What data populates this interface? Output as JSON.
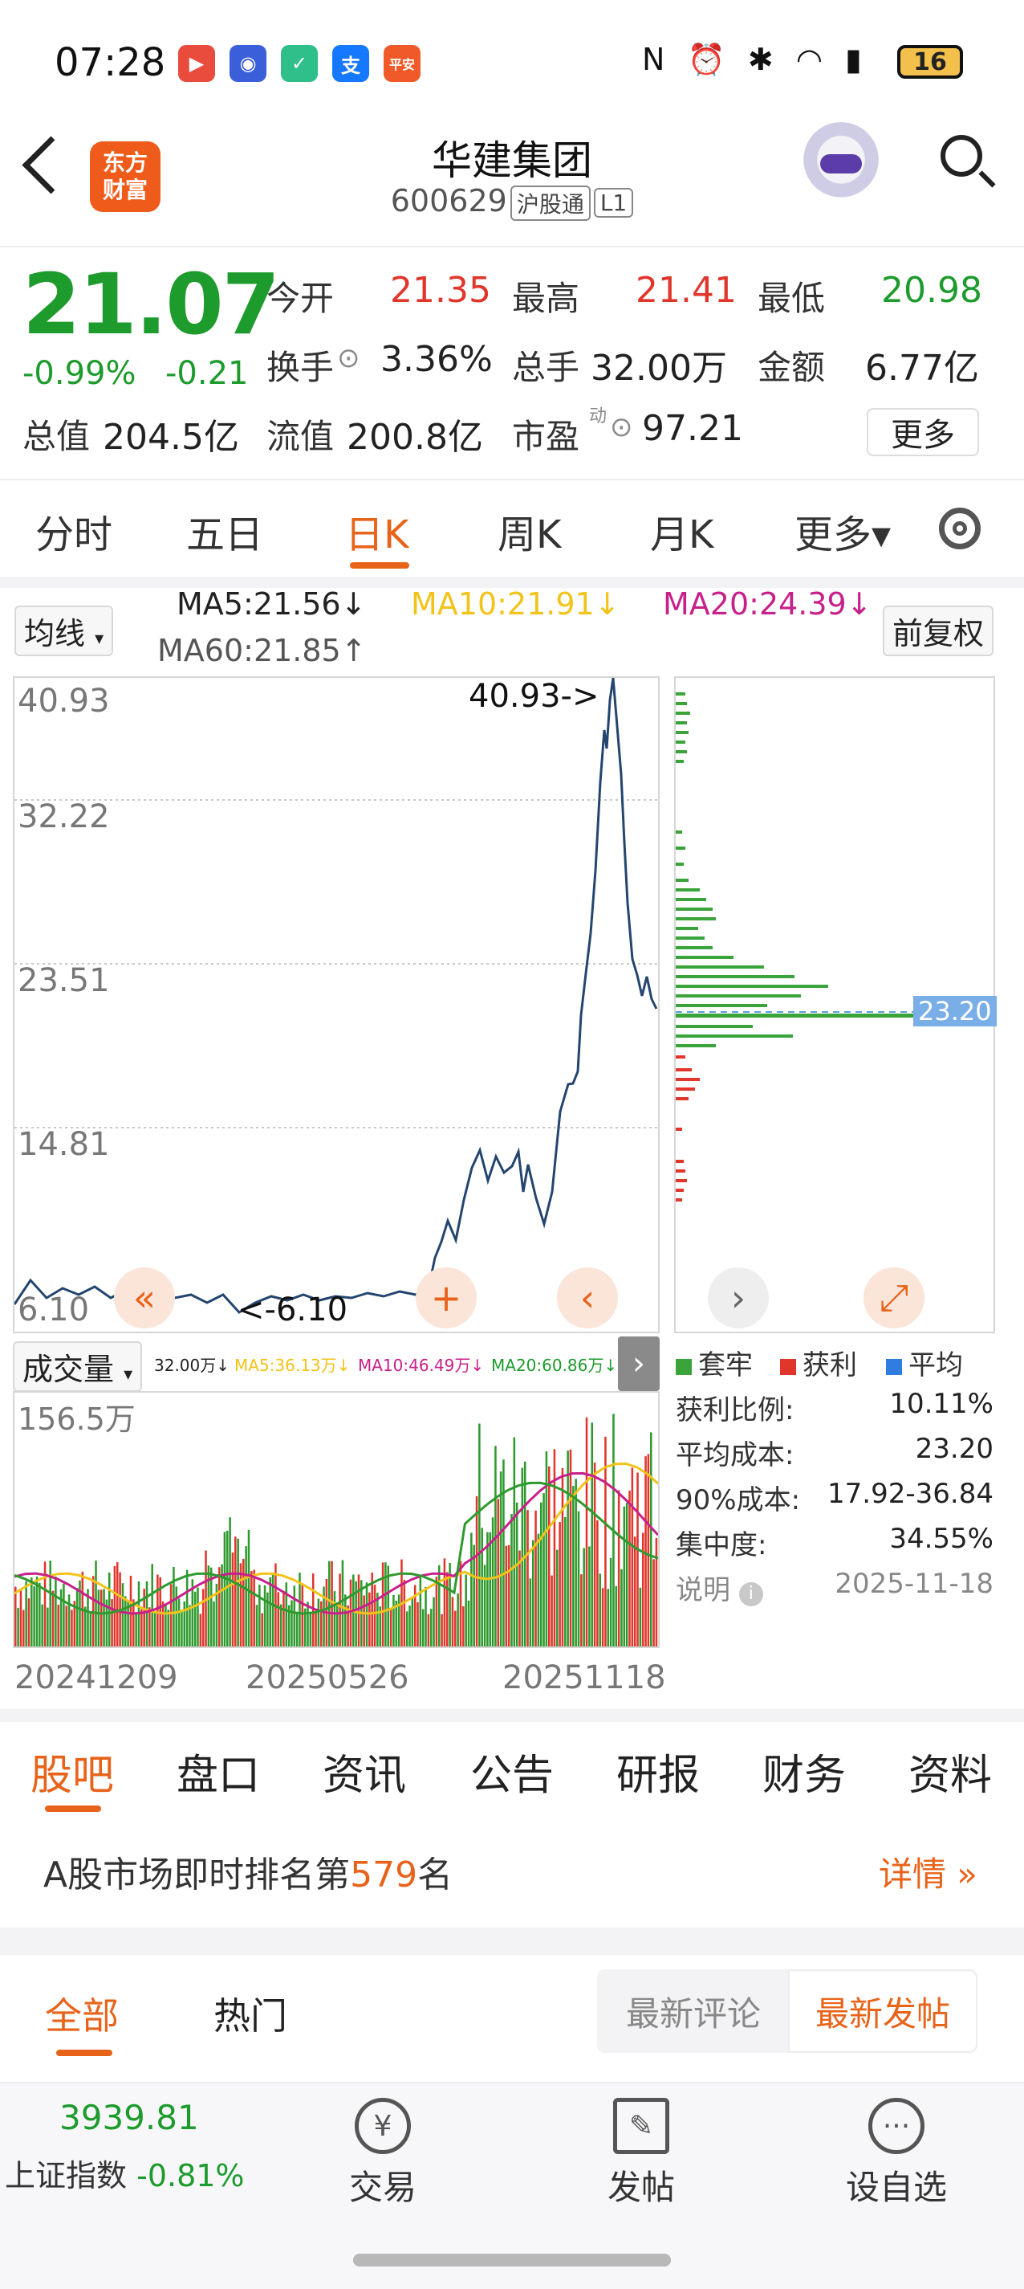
{
  "status": {
    "time": "07:28",
    "battery": "16"
  },
  "header": {
    "logo_line1": "东方",
    "logo_line2": "财富",
    "title": "华建集团",
    "code": "600629",
    "tag1": "沪股通",
    "tag2": "L1"
  },
  "quote": {
    "price": "21.07",
    "change_pct": "-0.99%",
    "change": "-0.21",
    "open_label": "今开",
    "open": "21.35",
    "high_label": "最高",
    "high": "21.41",
    "low_label": "最低",
    "low": "20.98",
    "turnover_label": "换手",
    "turnover": "3.36%",
    "volume_label": "总手",
    "volume": "32.00万",
    "amount_label": "金额",
    "amount": "6.77亿",
    "mktcap_label": "总值",
    "mktcap": "204.5亿",
    "float_label": "流值",
    "float_cap": "200.8亿",
    "pe_label": "市盈",
    "pe_super": "动",
    "pe": "97.21",
    "more": "更多"
  },
  "period_tabs": [
    "分时",
    "五日",
    "日K",
    "周K",
    "月K",
    "更多▾"
  ],
  "ma_row": {
    "selector": "均线",
    "ma5": "MA5:21.56↓",
    "ma10": "MA10:21.91↓",
    "ma20": "MA20:24.39↓",
    "ma60": "MA60:21.85↑",
    "adjust": "前复权",
    "colors": {
      "ma5": "#222222",
      "ma10": "#f2c318",
      "ma20": "#c8208a",
      "ma60": "#555555"
    }
  },
  "price_chart": {
    "y_labels": [
      "40.93",
      "32.22",
      "23.51",
      "14.81",
      "6.10"
    ],
    "max_annotation": "40.93->",
    "min_annotation": "<-6.10"
  },
  "chip_chart": {
    "avg_label": "23.20"
  },
  "volume": {
    "selector": "成交量",
    "vol": "32.00万↓",
    "ma5": "MA5:36.13万↓",
    "ma10": "MA10:46.49万↓",
    "ma20": "MA20:60.86万↓",
    "y_max": "156.5万",
    "dates": [
      "20241209",
      "20250526",
      "20251118"
    ]
  },
  "chip_info": {
    "legend": [
      "套牢",
      "获利",
      "平均"
    ],
    "legend_colors": [
      "#3aa33a",
      "#e0362c",
      "#2f7de1"
    ],
    "rows": [
      {
        "k": "获利比例:",
        "v": "10.11%"
      },
      {
        "k": "平均成本:",
        "v": "23.20"
      },
      {
        "k": "90%成本:",
        "v": "17.92-36.84"
      },
      {
        "k": "集中度:",
        "v": "34.55%"
      }
    ],
    "note_label": "说明",
    "note_date": "2025-11-18"
  },
  "bottom_tabs": [
    "股吧",
    "盘口",
    "资讯",
    "公告",
    "研报",
    "财务",
    "资料"
  ],
  "rank": {
    "prefix": "A股市场即时排名第",
    "num": "579",
    "suffix": "名",
    "detail": "详情 »"
  },
  "sub_tabs": [
    "全部",
    "热门"
  ],
  "segments": [
    "最新评论",
    "最新发帖"
  ],
  "index": {
    "value": "3939.81",
    "name": "上证指数",
    "change": "-0.81%"
  },
  "nav": [
    "交易",
    "发帖",
    "设自选"
  ]
}
